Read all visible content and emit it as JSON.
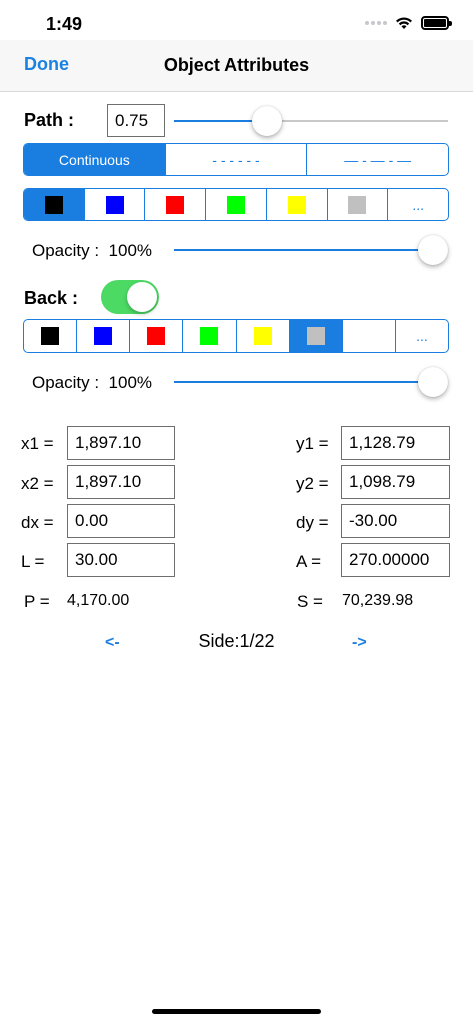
{
  "status": {
    "time": "1:49"
  },
  "nav": {
    "done": "Done",
    "title": "Object Attributes"
  },
  "path": {
    "label": "Path :",
    "width_value": "0.75",
    "width_slider_fraction": 0.25,
    "styles": [
      "Continuous",
      "- - - - - -",
      "— - — - —"
    ],
    "selected_style": "Continuous",
    "colors": [
      "#000000",
      "#0000ff",
      "#ff0000",
      "#00ff00",
      "#ffff00",
      "#c0c0c0"
    ],
    "more": "...",
    "selected_color": "#000000",
    "opacity_label": "Opacity :",
    "opacity_value": "100%"
  },
  "back": {
    "label": "Back :",
    "toggle_on": true,
    "colors": [
      "#000000",
      "#0000ff",
      "#ff0000",
      "#00ff00",
      "#ffff00",
      "#c0c0c0"
    ],
    "more": "...",
    "selected_color": "#c0c0c0",
    "opacity_label": "Opacity :",
    "opacity_value": "100%"
  },
  "fields": {
    "x1": {
      "label": "x1 =",
      "value": "1,897.10"
    },
    "y1": {
      "label": "y1 =",
      "value": "1,128.79"
    },
    "x2": {
      "label": "x2 =",
      "value": "1,897.10"
    },
    "y2": {
      "label": "y2 =",
      "value": "1,098.79"
    },
    "dx": {
      "label": "dx =",
      "value": "0.00"
    },
    "dy": {
      "label": "dy =",
      "value": "-30.00"
    },
    "L": {
      "label": "L =",
      "value": "30.00"
    },
    "A": {
      "label": "A =",
      "value": "270.00000"
    },
    "P": {
      "label": "P =",
      "value": "4,170.00"
    },
    "S": {
      "label": "S =",
      "value": "70,239.98"
    }
  },
  "pager": {
    "prev": "<-",
    "side": "Side:1/22",
    "next": "->"
  }
}
